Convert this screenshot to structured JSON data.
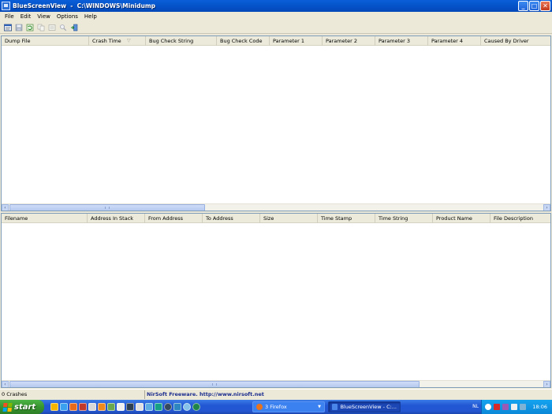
{
  "window": {
    "title": "BlueScreenView  -  C:\\WINDOWS\\Minidump",
    "minimize_label": "_",
    "maximize_label": "□",
    "close_label": "✕"
  },
  "menu": [
    "File",
    "Edit",
    "View",
    "Options",
    "Help"
  ],
  "toolbar": {
    "icons": [
      "html-report-icon",
      "save-icon",
      "refresh-icon",
      "copy-icon",
      "properties-icon",
      "find-icon",
      "exit-icon"
    ]
  },
  "top_table": {
    "columns": [
      "Dump File",
      "Crash Time",
      "Bug Check String",
      "Bug Check Code",
      "Parameter 1",
      "Parameter 2",
      "Parameter 3",
      "Parameter 4",
      "Caused By Driver"
    ],
    "sort_indicator": "▽",
    "rows": []
  },
  "bottom_table": {
    "columns": [
      "Filename",
      "Address In Stack",
      "From Address",
      "To Address",
      "Size",
      "Time Stamp",
      "Time String",
      "Product Name",
      "File Description"
    ],
    "rows": []
  },
  "scroll": {
    "left_arrow": "‹",
    "right_arrow": "›"
  },
  "status": {
    "count": "0 Crashes",
    "credit": "NirSoft Freeware.  http://www.nirsoft.net"
  },
  "taskbar": {
    "start_label": "start",
    "tasks": [
      "3 Firefox",
      "BlueScreenView - C:..."
    ],
    "firefox_caret": "▼",
    "language": "NL",
    "clock": "18:06"
  },
  "colors": {
    "titlebar": "#0453c9",
    "taskbar": "#2257d4",
    "start": "#37952f",
    "tray": "#0b88d8"
  }
}
